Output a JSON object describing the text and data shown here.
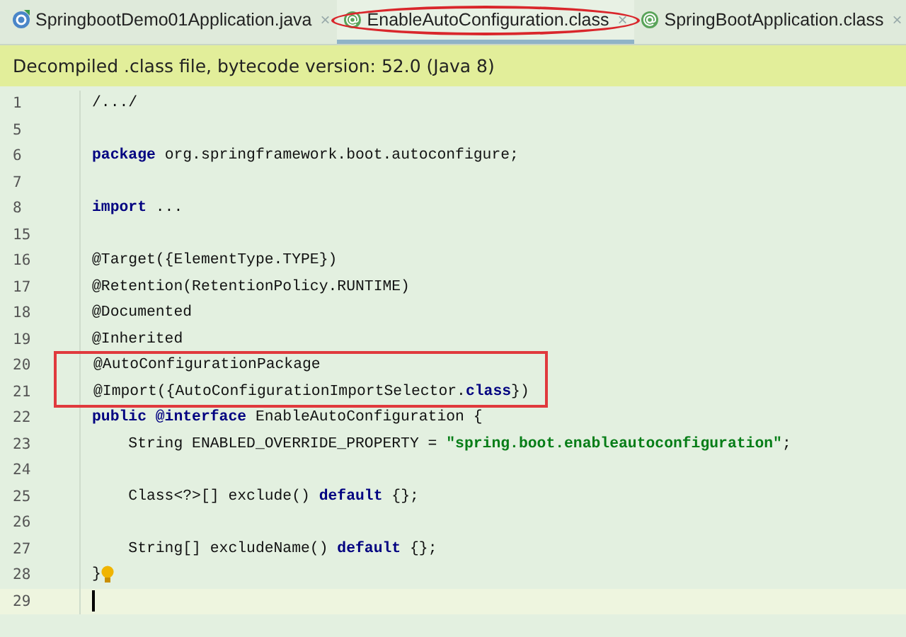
{
  "tabs": [
    {
      "label": "SpringbootDemo01Application.java",
      "kind": "java",
      "selected": false,
      "circled": false,
      "close": "×"
    },
    {
      "label": "EnableAutoConfiguration.class",
      "kind": "annotation",
      "selected": true,
      "circled": true,
      "close": "×"
    },
    {
      "label": "SpringBootApplication.class",
      "kind": "annotation",
      "selected": false,
      "circled": false,
      "close": "×"
    }
  ],
  "banner": "Decompiled .class file, bytecode version: 52.0 (Java 8)",
  "lines": [
    {
      "number": "1",
      "boxed": false,
      "current": false,
      "hint": false,
      "tokens": [
        {
          "text": "/.../",
          "kind": "plain"
        }
      ]
    },
    {
      "number": "5",
      "boxed": false,
      "current": false,
      "hint": false
    },
    {
      "number": "6",
      "boxed": false,
      "current": false,
      "hint": false,
      "tokens": [
        {
          "text": "package",
          "kind": "keyword"
        },
        {
          "text": " org.springframework.boot.autoconfigure;",
          "kind": "plain"
        }
      ]
    },
    {
      "number": "7",
      "boxed": false,
      "current": false,
      "hint": false
    },
    {
      "number": "8",
      "boxed": false,
      "current": false,
      "hint": false,
      "tokens": [
        {
          "text": "import",
          "kind": "keyword"
        },
        {
          "text": " ...",
          "kind": "plain"
        }
      ]
    },
    {
      "number": "15",
      "boxed": false,
      "current": false,
      "hint": false
    },
    {
      "number": "16",
      "boxed": false,
      "current": false,
      "hint": false,
      "tokens": [
        {
          "text": "@Target({ElementType.TYPE})",
          "kind": "plain"
        }
      ]
    },
    {
      "number": "17",
      "boxed": false,
      "current": false,
      "hint": false,
      "tokens": [
        {
          "text": "@Retention(RetentionPolicy.RUNTIME)",
          "kind": "plain"
        }
      ]
    },
    {
      "number": "18",
      "boxed": false,
      "current": false,
      "hint": false,
      "tokens": [
        {
          "text": "@Documented",
          "kind": "plain"
        }
      ]
    },
    {
      "number": "19",
      "boxed": false,
      "current": false,
      "hint": false,
      "tokens": [
        {
          "text": "@Inherited",
          "kind": "plain"
        }
      ]
    },
    {
      "number": "20",
      "boxed": true,
      "current": false,
      "hint": false,
      "tokens": [
        {
          "text": "@AutoConfigurationPackage",
          "kind": "plain"
        }
      ]
    },
    {
      "number": "21",
      "boxed": true,
      "current": false,
      "hint": false,
      "tokens": [
        {
          "text": "@Import({AutoConfigurationImportSelector.",
          "kind": "plain"
        },
        {
          "text": "class",
          "kind": "keyword"
        },
        {
          "text": "})",
          "kind": "plain"
        }
      ]
    },
    {
      "number": "22",
      "boxed": false,
      "current": false,
      "hint": false,
      "tokens": [
        {
          "text": "public @interface",
          "kind": "keyword"
        },
        {
          "text": " EnableAutoConfiguration {",
          "kind": "plain"
        }
      ]
    },
    {
      "number": "23",
      "boxed": false,
      "current": false,
      "hint": false,
      "tokens": [
        {
          "text": "    String ENABLED_OVERRIDE_PROPERTY = ",
          "kind": "plain"
        },
        {
          "text": "\"spring.boot.enableautoconfiguration\"",
          "kind": "string"
        },
        {
          "text": ";",
          "kind": "plain"
        }
      ]
    },
    {
      "number": "24",
      "boxed": false,
      "current": false,
      "hint": false
    },
    {
      "number": "25",
      "boxed": false,
      "current": false,
      "hint": false,
      "tokens": [
        {
          "text": "    Class<?>[] exclude() ",
          "kind": "plain"
        },
        {
          "text": "default",
          "kind": "keyword"
        },
        {
          "text": " {};",
          "kind": "plain"
        }
      ]
    },
    {
      "number": "26",
      "boxed": false,
      "current": false,
      "hint": false
    },
    {
      "number": "27",
      "boxed": false,
      "current": false,
      "hint": false,
      "tokens": [
        {
          "text": "    String[] excludeName() ",
          "kind": "plain"
        },
        {
          "text": "default",
          "kind": "keyword"
        },
        {
          "text": " {};",
          "kind": "plain"
        }
      ]
    },
    {
      "number": "28",
      "boxed": false,
      "current": false,
      "hint": true,
      "tokens": [
        {
          "text": "}",
          "kind": "plain"
        }
      ]
    },
    {
      "number": "29",
      "boxed": false,
      "current": true,
      "hint": false
    }
  ]
}
